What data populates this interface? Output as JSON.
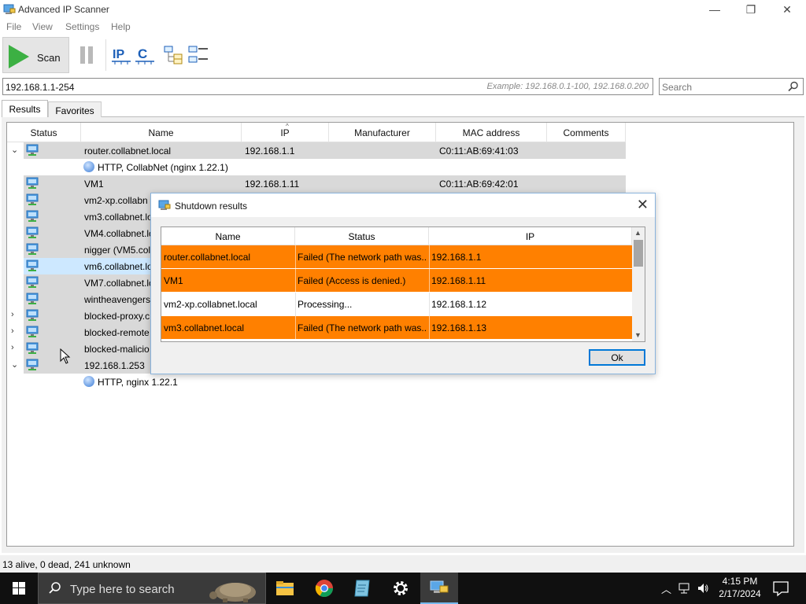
{
  "window": {
    "title": "Advanced IP Scanner",
    "controls": {
      "minimize": "—",
      "restore": "❐",
      "close": "✕"
    }
  },
  "menu": [
    "File",
    "View",
    "Settings",
    "Help"
  ],
  "toolbar": {
    "scan_label": "Scan",
    "icons": [
      "play-icon",
      "pause-icon",
      "ip-icon",
      "c-class-icon",
      "expand-all-icon",
      "collapse-all-icon"
    ]
  },
  "address": {
    "value": "192.168.1.1-254",
    "example": "Example: 192.168.0.1-100, 192.168.0.200"
  },
  "search": {
    "placeholder": "Search"
  },
  "tabs": [
    "Results",
    "Favorites"
  ],
  "list": {
    "columns": [
      "Status",
      "Name",
      "IP",
      "Manufacturer",
      "MAC address",
      "Comments"
    ],
    "rows": [
      {
        "expander": "⌄",
        "name": "router.collabnet.local",
        "ip": "192.168.1.1",
        "mac": "C0:11:AB:69:41:03"
      },
      {
        "service": "HTTP, CollabNet (nginx 1.22.1)"
      },
      {
        "expander": "",
        "name": "VM1",
        "ip": "192.168.1.11",
        "mac": "C0:11:AB:69:42:01"
      },
      {
        "expander": "",
        "name": "vm2-xp.collabn",
        "ip": "",
        "mac": ""
      },
      {
        "expander": "",
        "name": "vm3.collabnet.lo",
        "ip": "",
        "mac": ""
      },
      {
        "expander": "",
        "name": "VM4.collabnet.lo",
        "ip": "",
        "mac": ""
      },
      {
        "expander": "",
        "name": "nigger (VM5.coll",
        "ip": "",
        "mac": ""
      },
      {
        "expander": "",
        "name": "vm6.collabnet.lo",
        "ip": "",
        "mac": "",
        "selected": true
      },
      {
        "expander": "",
        "name": "VM7.collabnet.lo",
        "ip": "",
        "mac": ""
      },
      {
        "expander": "",
        "name": "wintheavengers",
        "ip": "",
        "mac": ""
      },
      {
        "expander": "›",
        "name": "blocked-proxy.c",
        "ip": "",
        "mac": ""
      },
      {
        "expander": "›",
        "name": "blocked-remote",
        "ip": "",
        "mac": ""
      },
      {
        "expander": "›",
        "name": "blocked-malicio",
        "ip": "",
        "mac": ""
      },
      {
        "expander": "⌄",
        "name": "192.168.1.253",
        "ip": "",
        "mac": ""
      },
      {
        "service": "HTTP, nginx 1.22.1"
      }
    ]
  },
  "dialog": {
    "title": "Shutdown results",
    "columns": [
      "Name",
      "Status",
      "IP"
    ],
    "rows": [
      {
        "name": "router.collabnet.local",
        "status": "Failed (The network path was...",
        "ip": "192.168.1.1",
        "failed": true
      },
      {
        "name": "VM1",
        "status": "Failed (Access is denied.)",
        "ip": "192.168.1.11",
        "failed": true
      },
      {
        "name": "vm2-xp.collabnet.local",
        "status": "Processing...",
        "ip": "192.168.1.12",
        "failed": false
      },
      {
        "name": "vm3.collabnet.local",
        "status": "Failed (The network path was...",
        "ip": "192.168.1.13",
        "failed": true
      }
    ],
    "ok_label": "Ok",
    "failed_color": "#ff8000"
  },
  "statusbar": {
    "text": "13 alive, 0 dead, 241 unknown"
  },
  "taskbar": {
    "search_placeholder": "Type here to search",
    "clock_time": "4:15 PM",
    "clock_date": "2/17/2024",
    "apps": [
      "file-explorer-icon",
      "chrome-icon",
      "notepad-icon",
      "settings-icon",
      "advanced-ip-scanner-icon"
    ]
  }
}
